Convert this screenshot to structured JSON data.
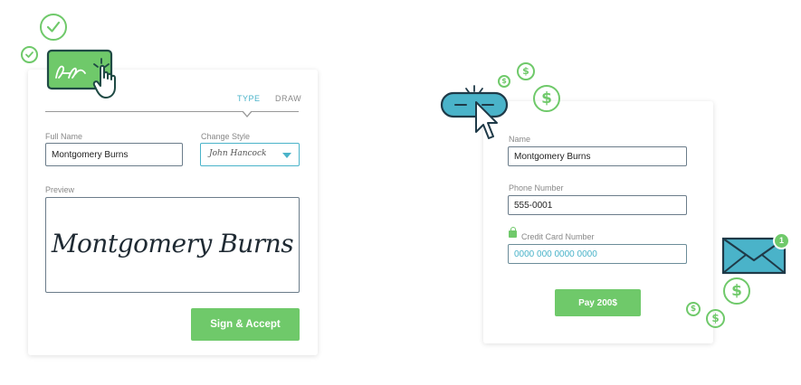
{
  "signature_form": {
    "tabs": {
      "type": "TYPE",
      "draw": "DRAW"
    },
    "full_name_label": "Full Name",
    "full_name_value": "Montgomery Burns",
    "change_style_label": "Change Style",
    "change_style_value": "John Hancock",
    "preview_label": "Preview",
    "preview_signature": "Montgomery Burns",
    "submit_label": "Sign & Accept"
  },
  "payment_form": {
    "name_label": "Name",
    "name_value": "Montgomery Burns",
    "phone_label": "Phone Number",
    "phone_value": "555-0001",
    "card_label": "Credit Card Number",
    "card_placeholder": "0000 000 0000 0000",
    "pay_label": "Pay 200$"
  },
  "decor": {
    "dollar_symbol": "$",
    "notification_count": "1",
    "icons": [
      "check-circle-icon",
      "signature-card-icon",
      "hand-cursor-icon",
      "dollar-coin-icon",
      "link-pill-icon",
      "arrow-cursor-icon",
      "envelope-icon"
    ]
  },
  "colors": {
    "accent_teal": "#4ab3c9",
    "accent_green": "#6fc96a",
    "card_border": "#6b7c8a"
  }
}
